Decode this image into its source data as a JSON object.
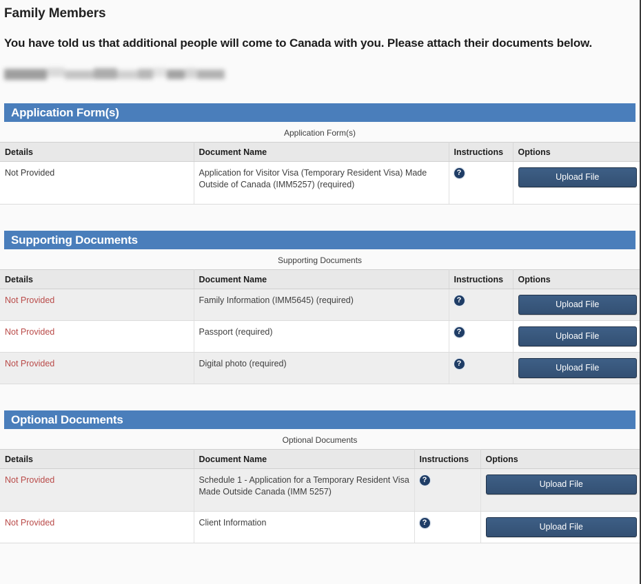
{
  "page": {
    "title": "Family Members",
    "intro": "You have told us that additional people will come to Canada with you. Please attach their documents below.",
    "redacted_label": ""
  },
  "icons": {
    "help": "?",
    "help_name": "help-question-icon"
  },
  "labels": {
    "upload_file": "Upload File"
  },
  "colors": {
    "section_banner": "#4a7ebb",
    "upload_button": "#36547a",
    "status_not_provided_red": "#b94a48",
    "status_not_provided_grey": "#3a3a3a",
    "page_background": "#fafafa"
  },
  "sections": [
    {
      "id": "application-forms",
      "banner": "Application Form(s)",
      "caption": "Application Form(s)",
      "columns": [
        "Details",
        "Document Name",
        "Instructions",
        "Options"
      ],
      "rows": [
        {
          "details": "Not Provided",
          "details_style": "grey",
          "document_name": "Application for Visitor Visa (Temporary Resident Visa) Made Outside of Canada (IMM5257)",
          "required": "(required)",
          "instructions": "?",
          "option": "Upload File"
        }
      ]
    },
    {
      "id": "supporting-documents",
      "banner": "Supporting Documents",
      "caption": "Supporting Documents",
      "columns": [
        "Details",
        "Document Name",
        "Instructions",
        "Options"
      ],
      "rows": [
        {
          "details": "Not Provided",
          "details_style": "red",
          "document_name": "Family Information (IMM5645)",
          "required": "(required)",
          "instructions": "?",
          "option": "Upload File"
        },
        {
          "details": "Not Provided",
          "details_style": "red",
          "document_name": "Passport",
          "required": "(required)",
          "instructions": "?",
          "option": "Upload File"
        },
        {
          "details": "Not Provided",
          "details_style": "red",
          "document_name": "Digital photo",
          "required": "(required)",
          "instructions": "?",
          "option": "Upload File"
        }
      ]
    },
    {
      "id": "optional-documents",
      "banner": "Optional Documents",
      "caption": "Optional Documents",
      "columns": [
        "Details",
        "Document Name",
        "Instructions",
        "Options"
      ],
      "rows": [
        {
          "details": "Not Provided",
          "details_style": "red",
          "document_name": "Schedule 1 - Application for a Temporary Resident Visa Made Outside Canada (IMM 5257)",
          "required": "",
          "instructions": "?",
          "option": "Upload File"
        },
        {
          "details": "Not Provided",
          "details_style": "red",
          "document_name": "Client Information",
          "required": "",
          "instructions": "?",
          "option": "Upload File"
        }
      ]
    }
  ]
}
